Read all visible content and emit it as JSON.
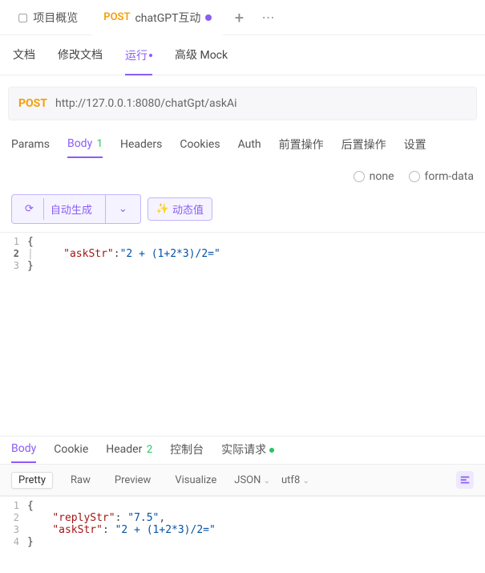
{
  "topTabs": {
    "overview": "项目概览",
    "api": {
      "method": "POST",
      "name": "chatGPT互动"
    }
  },
  "subTabs": {
    "doc": "文档",
    "editDoc": "修改文档",
    "run": "运行",
    "mock": "高级 Mock"
  },
  "url": {
    "method": "POST",
    "value": "http://127.0.0.1:8080/chatGpt/askAi"
  },
  "reqTabs": {
    "params": "Params",
    "body": "Body",
    "bodyCount": "1",
    "headers": "Headers",
    "cookies": "Cookies",
    "auth": "Auth",
    "pre": "前置操作",
    "post": "后置操作",
    "settings": "设置"
  },
  "bodyTypes": {
    "none": "none",
    "formdata": "form-data"
  },
  "editorToolbar": {
    "autogen": "自动生成",
    "dynamic": "动态值"
  },
  "requestBody": {
    "line1": "{",
    "key2": "\"askStr\"",
    "val2": "\"2 + (1+2*3)/2=\"",
    "line3": "}"
  },
  "respTabs": {
    "body": "Body",
    "cookie": "Cookie",
    "header": "Header",
    "headerCount": "2",
    "console": "控制台",
    "actual": "实际请求"
  },
  "respToolbar": {
    "pretty": "Pretty",
    "raw": "Raw",
    "preview": "Preview",
    "visualize": "Visualize",
    "format": "JSON",
    "encoding": "utf8"
  },
  "responseBody": {
    "line1": "{",
    "key2": "\"replyStr\"",
    "val2": "\"7.5\"",
    "key3": "\"askStr\"",
    "val3": "\"2 + (1+2*3)/2=\"",
    "line4": "}"
  }
}
